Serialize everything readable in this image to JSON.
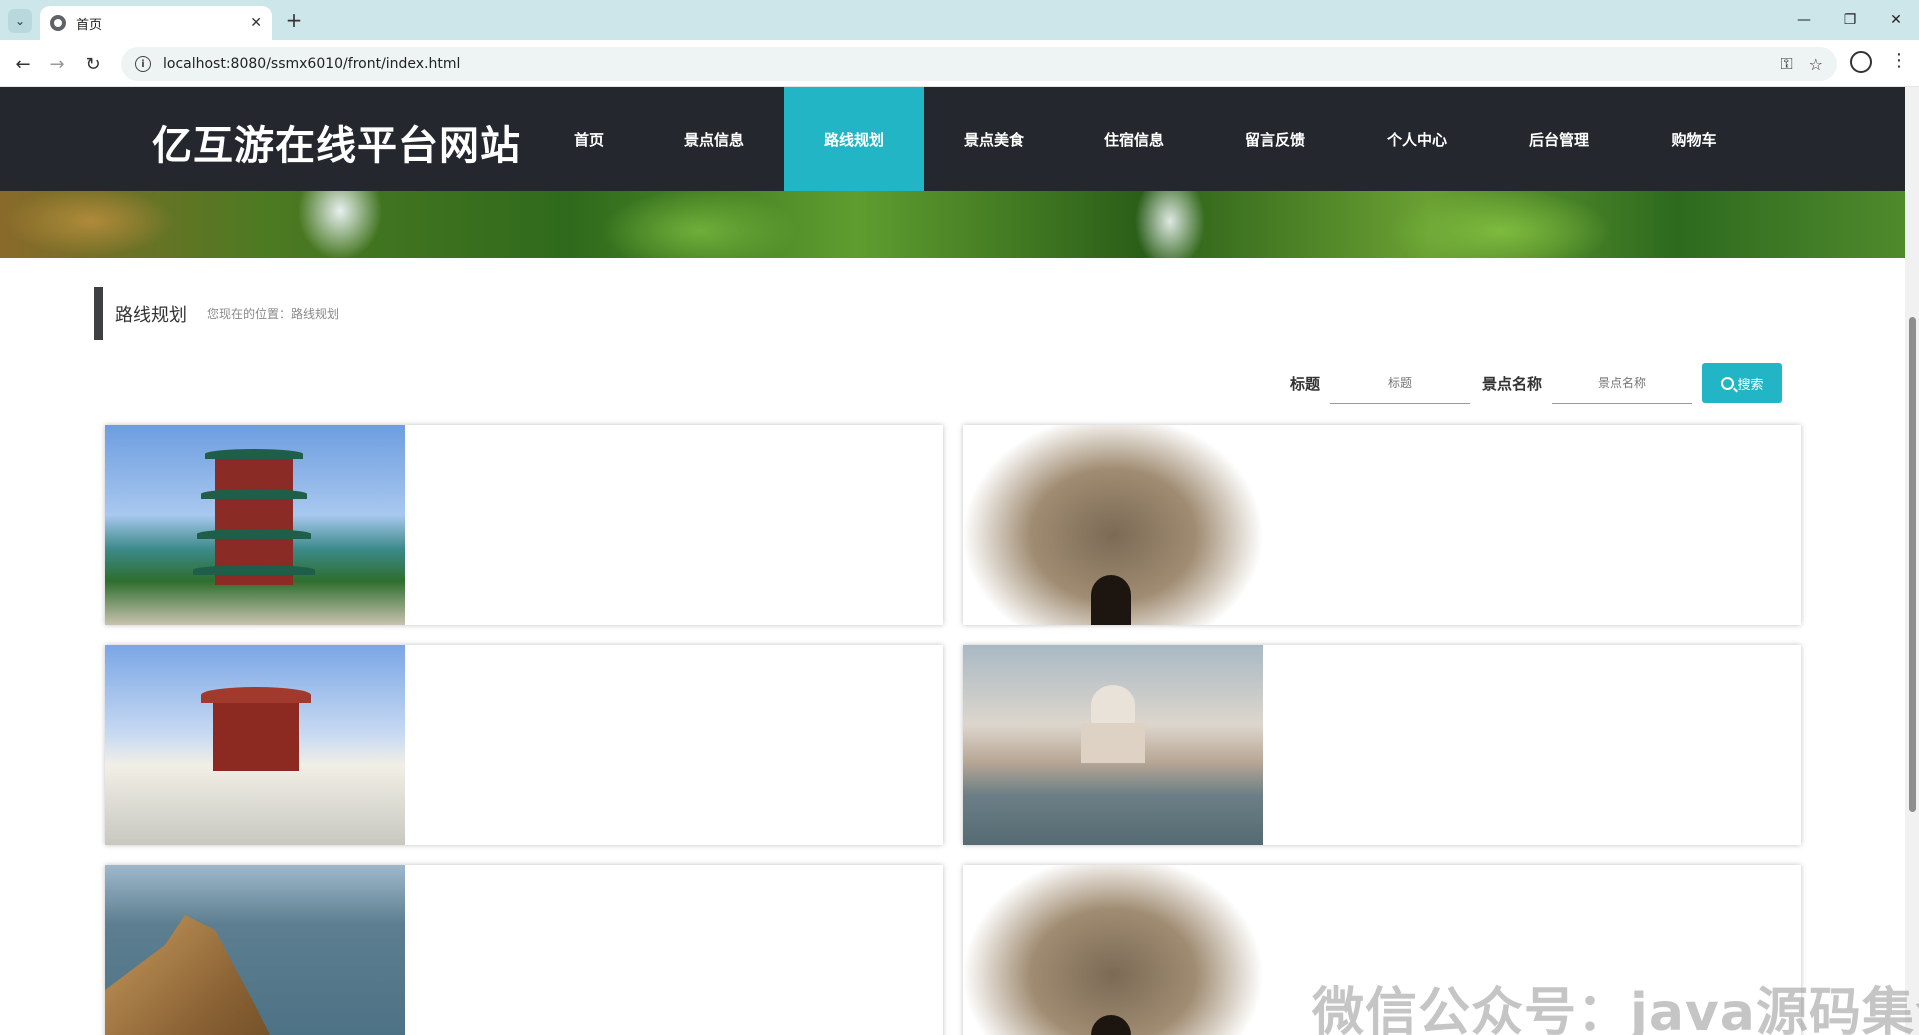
{
  "browser": {
    "tab_title": "首页",
    "url": "localhost:8080/ssmx6010/front/index.html"
  },
  "site": {
    "title": "亿互游在线平台网站",
    "nav": [
      {
        "label": "首页",
        "active": false
      },
      {
        "label": "景点信息",
        "active": false
      },
      {
        "label": "路线规划",
        "active": true
      },
      {
        "label": "景点美食",
        "active": false
      },
      {
        "label": "住宿信息",
        "active": false
      },
      {
        "label": "留言反馈",
        "active": false
      },
      {
        "label": "个人中心",
        "active": false
      },
      {
        "label": "后台管理",
        "active": false
      },
      {
        "label": "购物车",
        "active": false
      }
    ],
    "accent_color": "#22b5c6",
    "header_color": "#24272d"
  },
  "section": {
    "title": "路线规划",
    "breadcrumb": "您现在的位置：路线规划"
  },
  "search": {
    "title_label": "标题",
    "title_placeholder": "标题",
    "spot_label": "景点名称",
    "spot_placeholder": "景点名称",
    "button_label": "搜索"
  },
  "cards": [
    {
      "image": "pavilion-tower-photo"
    },
    {
      "image": "carved-gate-photo"
    },
    {
      "image": "red-temple-photo"
    },
    {
      "image": "white-mosque-photo"
    },
    {
      "image": "seaside-cliff-photo"
    },
    {
      "image": "carved-gate-photo"
    }
  ],
  "watermark": "微信公众号：java源码集合"
}
